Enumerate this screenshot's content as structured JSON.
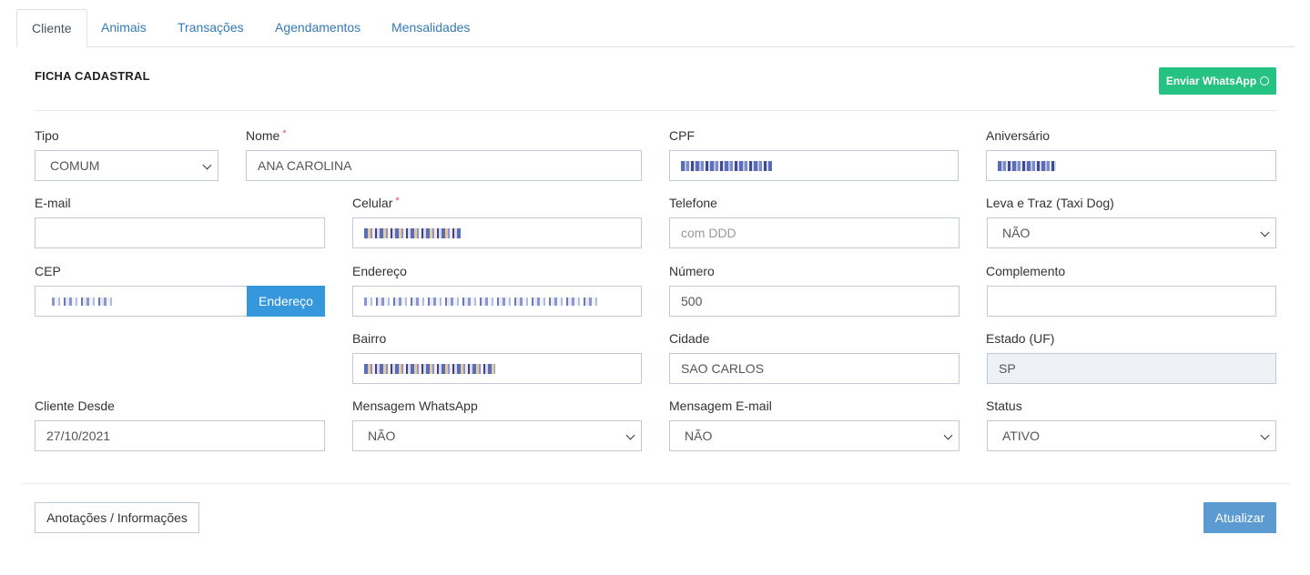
{
  "tabs": [
    {
      "label": "Cliente",
      "active": true
    },
    {
      "label": "Animais"
    },
    {
      "label": "Transações"
    },
    {
      "label": "Agendamentos"
    },
    {
      "label": "Mensalidades"
    }
  ],
  "section": {
    "title": "FICHA CADASTRAL",
    "whatsapp_button": "Enviar WhatsApp",
    "whatsapp_icon": "whatsapp-icon"
  },
  "form": {
    "tipo": {
      "label": "Tipo",
      "value": "COMUM"
    },
    "nome": {
      "label": "Nome",
      "required": "*",
      "value": "ANA CAROLINA"
    },
    "cpf": {
      "label": "CPF",
      "value": "[redacted]"
    },
    "aniversario": {
      "label": "Aniversário",
      "value": "[redacted]"
    },
    "email": {
      "label": "E-mail",
      "value": ""
    },
    "celular": {
      "label": "Celular",
      "required": "*",
      "value": "[redacted]"
    },
    "telefone": {
      "label": "Telefone",
      "placeholder": "com DDD"
    },
    "taxi_dog": {
      "label": "Leva e Traz (Taxi Dog)",
      "value": "NÃO"
    },
    "cep": {
      "label": "CEP",
      "value": "[redacted]",
      "button": "Endereço"
    },
    "endereco": {
      "label": "Endereço",
      "value": "[redacted]"
    },
    "numero": {
      "label": "Número",
      "value": "500"
    },
    "complemento": {
      "label": "Complemento",
      "value": ""
    },
    "bairro": {
      "label": "Bairro",
      "value": "[redacted]"
    },
    "cidade": {
      "label": "Cidade",
      "value": "SAO CARLOS"
    },
    "estado": {
      "label": "Estado (UF)",
      "value": "SP"
    },
    "cliente_desde": {
      "label": "Cliente Desde",
      "value": "27/10/2021"
    },
    "msg_whatsapp": {
      "label": "Mensagem WhatsApp",
      "value": "NÃO"
    },
    "msg_email": {
      "label": "Mensagem E-mail",
      "value": "NÃO"
    },
    "status": {
      "label": "Status",
      "value": "ATIVO"
    }
  },
  "footer": {
    "notes_button": "Anotações / Informações",
    "update_button": "Atualizar"
  }
}
